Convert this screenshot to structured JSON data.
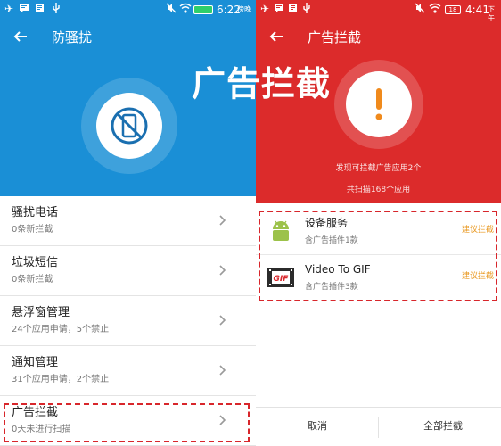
{
  "left": {
    "statusbar": {
      "icons": [
        "airplane-icon",
        "message-icon",
        "document-icon",
        "usb-icon",
        "mute-icon",
        "wifi-icon",
        "battery-icon"
      ],
      "battery_label": "",
      "time": "6:22",
      "period": "傍晚"
    },
    "title": "防骚扰",
    "hero_icon": "blocked-phone-icon",
    "colors": {
      "hero": "#1a8fd6",
      "dash": "#d8262b"
    },
    "items": [
      {
        "label": "骚扰电话",
        "sub": "0条新拦截"
      },
      {
        "label": "垃圾短信",
        "sub": "0条新拦截"
      },
      {
        "label": "悬浮窗管理",
        "sub": "24个应用申请，5个禁止"
      },
      {
        "label": "通知管理",
        "sub": "31个应用申请，2个禁止"
      },
      {
        "label": "广告拦截",
        "sub": "0天未进行扫描"
      }
    ]
  },
  "overlay_title": "广告拦截",
  "right": {
    "statusbar": {
      "icons": [
        "airplane-icon",
        "message-icon",
        "document-icon",
        "usb-icon",
        "mute-icon",
        "wifi-icon",
        "battery-icon"
      ],
      "battery_label": "18",
      "time": "4:41",
      "period": "下午"
    },
    "title": "广告拦截",
    "colors": {
      "hero": "#dc2b2b",
      "action": "#e8961b"
    },
    "found_text": "发现可拦截广告应用2个",
    "scanned_text": "共扫描168个应用",
    "apps": [
      {
        "name": "设备服务",
        "sub": "含广告插件1款",
        "action": "建议拦截",
        "icon": "android-icon"
      },
      {
        "name": "Video To GIF",
        "sub": "含广告插件3款",
        "action": "建议拦截",
        "icon": "gif-film-icon"
      }
    ],
    "buttons": {
      "cancel": "取消",
      "block_all": "全部拦截"
    }
  }
}
